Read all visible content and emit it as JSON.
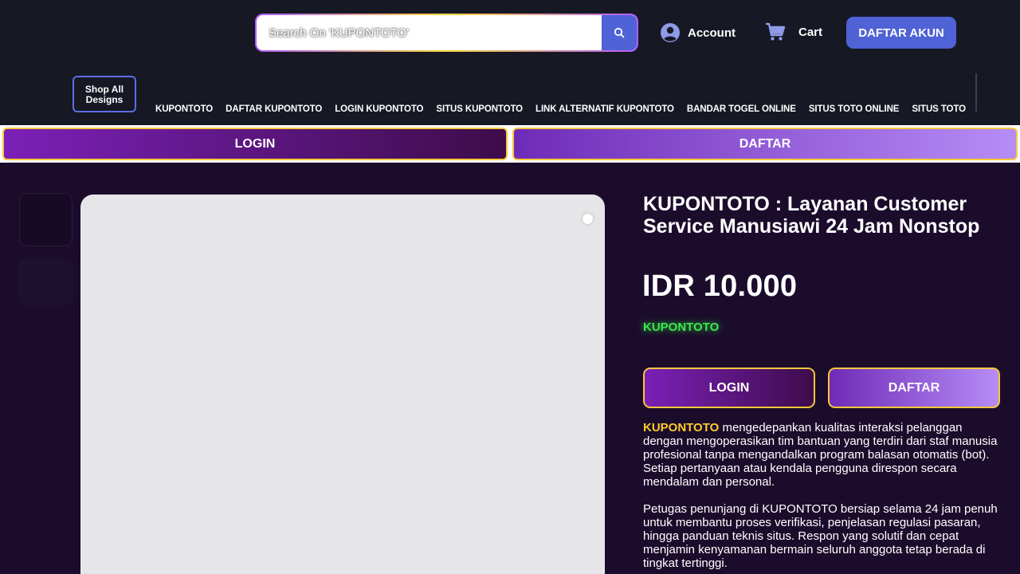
{
  "header": {
    "search": {
      "placeholder": "Search On 'KUPONTOTO'"
    },
    "account_label": "Account",
    "cart_label": "Cart",
    "daftar_akun_label": "DAFTAR AKUN",
    "shop_all_label": "Shop All Designs"
  },
  "nav": {
    "items": [
      "KUPONTOTO",
      "DAFTAR KUPONTOTO",
      "LOGIN KUPONTOTO",
      "SITUS KUPONTOTO",
      "LINK ALTERNATIF KUPONTOTO",
      "BANDAR TOGEL ONLINE",
      "SITUS TOTO ONLINE",
      "SITUS TOTO"
    ]
  },
  "strip": {
    "login_label": "LOGIN",
    "daftar_label": "DAFTAR"
  },
  "product": {
    "title": "KUPONTOTO : Layanan Customer Service Manusiawi 24 Jam Nonstop",
    "price": "IDR 10.000",
    "brand_tag": "KUPONTOTO",
    "login_label": "LOGIN",
    "daftar_label": "DAFTAR",
    "desc_highlight": "KUPONTOTO",
    "desc_1_rest": " mengedepankan kualitas interaksi pelanggan dengan mengoperasikan tim bantuan yang terdiri dari staf manusia profesional tanpa mengandalkan program balasan otomatis (bot). Setiap pertanyaan atau kendala pengguna direspon secara mendalam dan personal.",
    "desc_2": "Petugas penunjang di KUPONTOTO bersiap selama 24 jam penuh untuk membantu proses verifikasi, penjelasan regulasi pasaran, hingga panduan teknis situs. Respon yang solutif dan cepat menjamin kenyamanan bermain seluruh anggota tetap berada di tingkat tertinggi."
  },
  "colors": {
    "header_bg": "#161824",
    "page_bg": "#1c0c2c",
    "accent_blue": "#4f62d6",
    "gold_border": "#f5c93a",
    "highlight_yellow": "#ffcb2e",
    "brand_green": "#3fe64c"
  },
  "icons": {
    "search": "search-icon",
    "account": "user-circle-icon",
    "cart": "cart-icon"
  }
}
